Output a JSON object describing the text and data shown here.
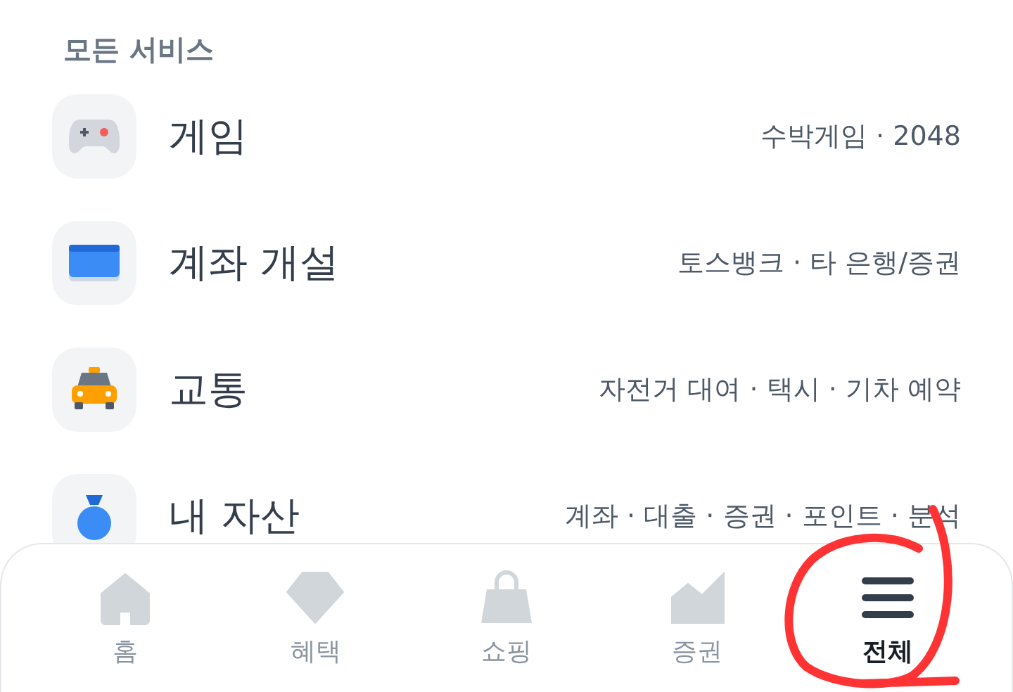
{
  "section_title": "모든 서비스",
  "services": [
    {
      "name": "게임",
      "description": "수박게임 · 2048"
    },
    {
      "name": "계좌 개설",
      "description": "토스뱅크 · 타 은행/증권"
    },
    {
      "name": "교통",
      "description": "자전거 대여 · 택시 · 기차 예약"
    },
    {
      "name": "내 자산",
      "description": "계좌 · 대출 · 증권 · 포인트 · 분석"
    }
  ],
  "tabs": [
    {
      "label": "홈",
      "selected": false
    },
    {
      "label": "혜택",
      "selected": false
    },
    {
      "label": "쇼핑",
      "selected": false
    },
    {
      "label": "증권",
      "selected": false
    },
    {
      "label": "전체",
      "selected": true
    }
  ],
  "annotation": {
    "color": "#ff3333"
  }
}
